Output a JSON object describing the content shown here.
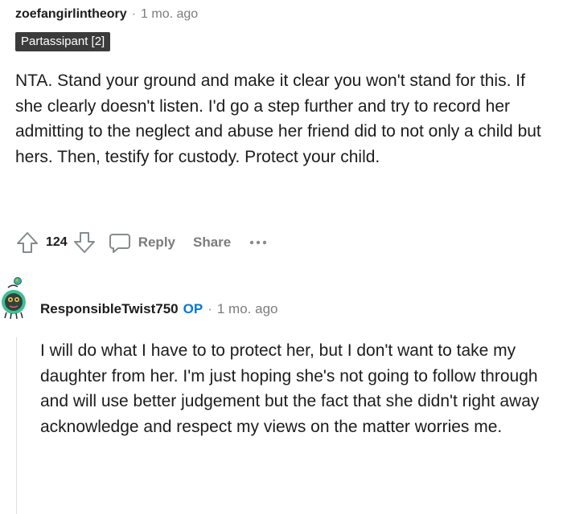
{
  "comment1": {
    "username": "zoefangirlintheory",
    "separator": "·",
    "time": "1 mo. ago",
    "flair": "Partassipant [2]",
    "body": "NTA. Stand your ground and make it clear you won't stand for this. If she clearly doesn't listen. I'd go a step further and try to record her admitting to the neglect and abuse her friend did to not only a child but hers. Then, testify for custody. Protect your child.",
    "votes": "124",
    "reply_label": "Reply",
    "share_label": "Share",
    "more_label": "···",
    "icons": {
      "upvote": "upvote-arrow-icon",
      "downvote": "downvote-arrow-icon",
      "reply": "speech-bubble-icon",
      "more": "ellipsis-icon"
    }
  },
  "comment2": {
    "username": "ResponsibleTwist750",
    "op_badge": "OP",
    "separator": "·",
    "time": "1 mo. ago",
    "body": "I will do what I have to to protect her, but I don't want to take my daughter from her. I'm just hoping she's not going to follow through and will use better judgement but the fact that she didn't right away acknowledge and respect my views on the matter worries me."
  },
  "colors": {
    "text": "#1c1c1c",
    "meta": "#7c7c7c",
    "flair_bg": "#3b3b3b",
    "op": "#0079d3",
    "thread_line": "#dcdfe3"
  }
}
